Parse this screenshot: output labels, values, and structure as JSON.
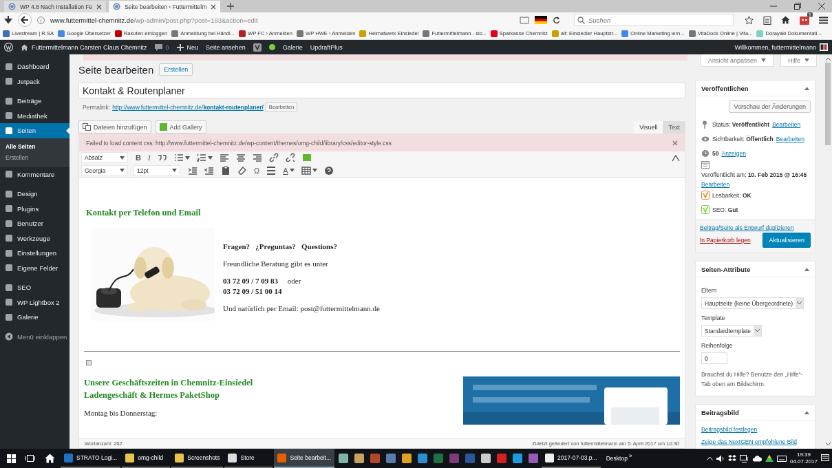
{
  "browser": {
    "tabs": [
      {
        "title": "WP 4.8 Nach Installation Fe",
        "selected": false
      },
      {
        "title": "Seite bearbeiten ‹ Futtermittelm",
        "selected": true
      }
    ],
    "url": {
      "host": "www.futtermittel-chemnitz.de",
      "path": "/wp-admin/post.php?post=193&action=edit"
    },
    "search": {
      "placeholder": "Suchen"
    },
    "extension_badge": "1",
    "bookmarks": [
      {
        "label": "Livestream | R.SA",
        "color": "#3b6fb6"
      },
      {
        "label": "Google Übersetzer",
        "color": "#4a86e8"
      },
      {
        "label": "Rakuten einloggen",
        "color": "#bf0000"
      },
      {
        "label": "Anmeldung bei Händl...",
        "color": "#777777"
      },
      {
        "label": "WP FC › Anmelden",
        "color": "#b22222"
      },
      {
        "label": "WP HWE › Anmelden",
        "color": "#777777"
      },
      {
        "label": "Heimatwerk Einsiedel",
        "color": "#c9a100"
      },
      {
        "label": "Futtermittelmann - sic...",
        "color": "#777777"
      },
      {
        "label": "Sparkasse Chemnitz",
        "color": "#e2001a"
      },
      {
        "label": "alt: Einsiedler Hauptstr...",
        "color": "#c9a100"
      },
      {
        "label": "Online Marketing lern...",
        "color": "#4285f4"
      },
      {
        "label": "VitaDock Online | Vita...",
        "color": "#777777"
      },
      {
        "label": "Dorayaki Dokumentati...",
        "color": "#7fd1c0"
      }
    ]
  },
  "admin_bar": {
    "site": "Futtermittelmann Carsten Claus Chemnitz",
    "comments": "0",
    "new": "Neu",
    "view": "Seite ansehen",
    "items": [
      "Galerie",
      "UpdraftPlus"
    ],
    "greeting": "Willkommen, futtermittelmann"
  },
  "sidebar": {
    "groups": [
      [
        {
          "label": "Dashboard",
          "selected": false
        },
        {
          "label": "Jetpack",
          "selected": false
        }
      ],
      [
        {
          "label": "Beiträge",
          "selected": false
        },
        {
          "label": "Mediathek",
          "selected": false
        },
        {
          "label": "Seiten",
          "selected": true,
          "children": [
            {
              "label": "Alle Seiten",
              "selected": true
            },
            {
              "label": "Erstellen",
              "selected": false
            }
          ]
        },
        {
          "label": "Kommentare",
          "selected": false
        }
      ],
      [
        {
          "label": "Design",
          "selected": false
        },
        {
          "label": "Plugins",
          "selected": false
        },
        {
          "label": "Benutzer",
          "selected": false
        },
        {
          "label": "Werkzeuge",
          "selected": false
        },
        {
          "label": "Einstellungen",
          "selected": false
        },
        {
          "label": "Eigene Felder",
          "selected": false
        }
      ],
      [
        {
          "label": "SEO",
          "selected": false
        },
        {
          "label": "WP Lightbox 2",
          "selected": false
        },
        {
          "label": "Galerie",
          "selected": false
        }
      ]
    ],
    "collapse": "Menü einklappen"
  },
  "screen_tabs": [
    "Ansicht anpassen",
    "Hilfe"
  ],
  "page": {
    "heading": "Seite bearbeiten",
    "add_new": "Erstellen",
    "title": "Kontakt & Routenplaner",
    "permalink": {
      "label": "Permalink:",
      "base": "http://www.futtermittel-chemnitz.de/",
      "slug": "kontakt-routenplaner/",
      "edit": "Bearbeiten"
    }
  },
  "editor": {
    "media_buttons": [
      "Dateien hinzufügen",
      "Add Gallery"
    ],
    "tabs": [
      {
        "label": "Visuell",
        "selected": true
      },
      {
        "label": "Text",
        "selected": false
      }
    ],
    "notice": "Failed to load content css: http://www.futtermittel-chemnitz.de/wp-content/themes/omg-child/library/css/editor-style.css",
    "toolbar": {
      "format": "Absatz",
      "bold": "B",
      "italic": "I",
      "font": "Georgia",
      "size": "12pt",
      "special_char": "Ω",
      "text_color": "A"
    },
    "content": {
      "heading": "Kontakt per Telefon und Email",
      "paragraphs": [
        {
          "bold": true,
          "lines": [
            "Fragen?   ¿Preguntas?   Questions?"
          ]
        },
        {
          "bold": false,
          "lines": [
            "Freundliche Beratung gibt es unter"
          ]
        },
        {
          "bold": false,
          "lines": [
            "**03 72 09 / 7 09 83**     oder",
            "**03 72 09 / 51 00 14**"
          ]
        },
        {
          "bold": false,
          "lines": [
            "Und natürlich per Email: post@futtermittelmann.de"
          ]
        }
      ],
      "hours_heading": [
        "Unsere Geschäftszeiten in Chemnitz-Einsiedel",
        "Ladengeschäft & Hermes PaketShop"
      ],
      "hours_label": "Montag bis Donnerstag:"
    },
    "word_count": "Wortanzahl: 262",
    "last_modified": "Zuletzt geändert von futtermittelmann am 5. April 2017 um 10:30"
  },
  "publish": {
    "title": "Veröffentlichen",
    "preview": "Vorschau der Änderungen",
    "rows": [
      {
        "kind": "pin",
        "text": "Status: **Veröffentlicht**",
        "link": "Bearbeiten"
      },
      {
        "kind": "eye",
        "text": "Sichtbarkeit: **Öffentlich**",
        "link": "Bearbeiten"
      },
      {
        "kind": "clock",
        "text": "**50**",
        "link": "Anzeigen"
      },
      {
        "kind": "calendar",
        "text": "Veröffentlicht am: **10. Feb 2015 @ 16:45**",
        "link": "Bearbeiten"
      },
      {
        "kind": "yoast",
        "color": "#e6851e",
        "text": "Lesbarkeit: **OK**"
      },
      {
        "kind": "yoast",
        "color": "#7ad03a",
        "text": "SEO: **Gut**"
      }
    ],
    "duplicate": "Beitrag/Seite als Entwurf duplizieren",
    "trash": "In Papierkorb legen",
    "update": "Aktualisieren"
  },
  "page_attributes": {
    "title": "Seiten-Attribute",
    "parent_label": "Eltern",
    "parent": "Hauptseite (keine Übergeordnete)",
    "template_label": "Template",
    "template": "Standardtemplate",
    "order_label": "Reihenfolge",
    "order": "0",
    "help": "Brauchst du Hilfe? Benutze den „Hilfe“-Tab oben am Bildschirm."
  },
  "featured_image": {
    "title": "Beitragsbild",
    "links": [
      "Beitragsbild festlegen",
      "Zeige das NextGEN empfohlene Bild"
    ]
  },
  "taskbar": {
    "apps": [
      {
        "kind": "app",
        "label": "STRATO Logi...",
        "color": "#1e73be",
        "selected": false
      },
      {
        "kind": "app",
        "label": "omg-child",
        "color": "#e8c44a",
        "selected": false
      },
      {
        "kind": "app",
        "label": "Screenshots",
        "color": "#e8c44a",
        "selected": false
      },
      {
        "kind": "app",
        "label": "Store",
        "color": "#dddddd",
        "selected": false
      },
      {
        "kind": "app",
        "label": "Seite bearbeit...",
        "color": "#e66000",
        "selected": true
      },
      {
        "kind": "icon",
        "color": "#7fb2a8",
        "selected": false
      },
      {
        "kind": "icon",
        "color": "#c8a060",
        "selected": false
      },
      {
        "kind": "icon",
        "color": "#b0472a",
        "selected": false
      },
      {
        "kind": "icon",
        "color": "#5a7bb0",
        "selected": false
      },
      {
        "kind": "icon",
        "color": "#e0a020",
        "selected": false
      },
      {
        "kind": "icon",
        "color": "#2a8fd0",
        "selected": false
      },
      {
        "kind": "icon",
        "color": "#1e7145",
        "selected": false
      },
      {
        "kind": "icon",
        "color": "#80397b",
        "selected": false
      },
      {
        "kind": "icon",
        "color": "#2b579a",
        "selected": false
      },
      {
        "kind": "icon",
        "color": "#cccccc",
        "selected": false
      },
      {
        "kind": "icon",
        "color": "#d42020",
        "selected": false
      },
      {
        "kind": "icon",
        "color": "#1a9be0",
        "selected": false
      },
      {
        "kind": "icon",
        "color": "#9b59b6",
        "selected": false
      },
      {
        "kind": "app",
        "label": "2017-07-03.p...",
        "color": "#eeeeee",
        "selected": false
      }
    ],
    "desktop": "Desktop",
    "chevron": "»",
    "time": "19:39",
    "date": "04.07.2017"
  }
}
